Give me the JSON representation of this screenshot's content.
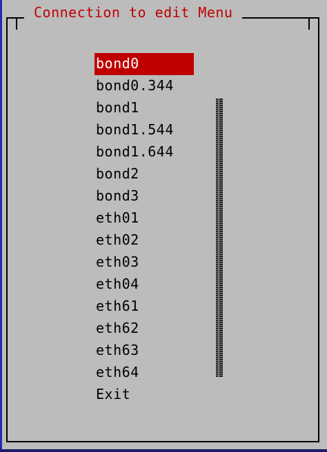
{
  "window": {
    "title": "Connection to edit Menu"
  },
  "menu": {
    "items": [
      {
        "label": "bond0",
        "selected": true
      },
      {
        "label": "bond0.344",
        "selected": false
      },
      {
        "label": "bond1",
        "selected": false
      },
      {
        "label": "bond1.544",
        "selected": false
      },
      {
        "label": "bond1.644",
        "selected": false
      },
      {
        "label": "bond2",
        "selected": false
      },
      {
        "label": "bond3",
        "selected": false
      },
      {
        "label": "eth01",
        "selected": false
      },
      {
        "label": "eth02",
        "selected": false
      },
      {
        "label": "eth03",
        "selected": false
      },
      {
        "label": "eth04",
        "selected": false
      },
      {
        "label": "eth61",
        "selected": false
      },
      {
        "label": "eth62",
        "selected": false
      },
      {
        "label": "eth63",
        "selected": false
      },
      {
        "label": "eth64",
        "selected": false
      },
      {
        "label": "Exit",
        "selected": false
      }
    ]
  },
  "colors": {
    "background": "#bcbcbc",
    "title_text": "#c00000",
    "selection_bg": "#c00000",
    "selection_text": "#ffffff",
    "text": "#000000"
  }
}
